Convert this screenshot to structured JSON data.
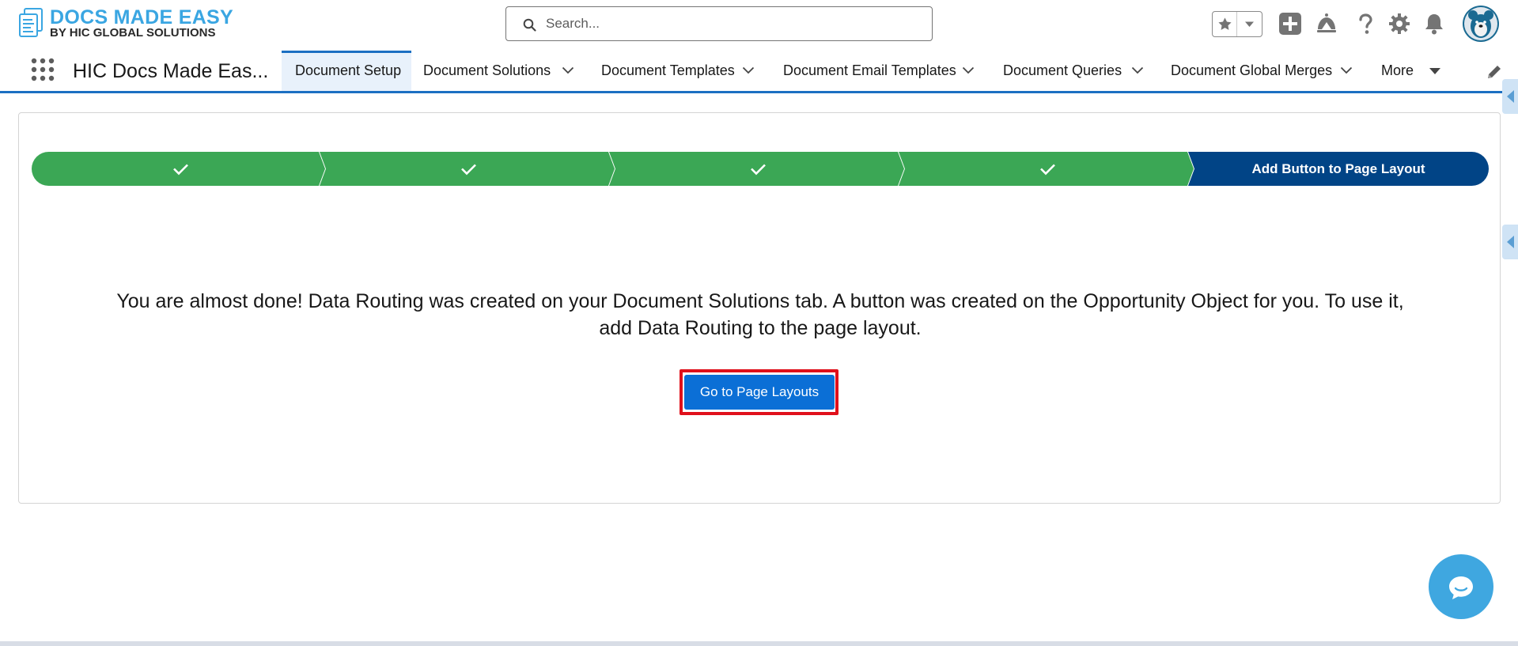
{
  "brand": {
    "title": "DOCS MADE EASY",
    "subtitle": "BY HIC GLOBAL SOLUTIONS",
    "logo_icon": "document-stack-icon"
  },
  "search": {
    "placeholder": "Search..."
  },
  "header_icons": [
    "favorites-star-icon",
    "favorites-dropdown-icon",
    "global-actions-plus-icon",
    "trailhead-icon",
    "help-icon",
    "setup-gear-icon",
    "notifications-bell-icon",
    "user-avatar"
  ],
  "nav": {
    "app_name": "HIC Docs Made Eas...",
    "tabs": [
      {
        "label": "Document Setup",
        "active": true,
        "has_menu": false
      },
      {
        "label": "Document Solutions",
        "active": false,
        "has_menu": true
      },
      {
        "label": "Document Templates",
        "active": false,
        "has_menu": true
      },
      {
        "label": "Document Email Templates",
        "active": false,
        "has_menu": true
      },
      {
        "label": "Document Queries",
        "active": false,
        "has_menu": true
      },
      {
        "label": "Document Global Merges",
        "active": false,
        "has_menu": true
      }
    ],
    "more_label": "More"
  },
  "progress": {
    "steps": [
      {
        "state": "complete",
        "icon": "check-icon"
      },
      {
        "state": "complete",
        "icon": "check-icon"
      },
      {
        "state": "complete",
        "icon": "check-icon"
      },
      {
        "state": "complete",
        "icon": "check-icon"
      },
      {
        "state": "current",
        "label": "Add Button to Page Layout"
      }
    ]
  },
  "main": {
    "message_line1": "You are almost done! Data Routing was created on your Document Solutions tab. A button was created on the Opportunity Object for you. To use it,",
    "message_line2": "add Data Routing to the page layout.",
    "button_label": "Go to Page Layouts"
  },
  "colors": {
    "accent": "#1b6fc2",
    "step_complete": "#3ba755",
    "step_current": "#014486",
    "button": "#0b6fd6",
    "highlight_outline": "#e0101b",
    "chat": "#3fa7e0"
  }
}
